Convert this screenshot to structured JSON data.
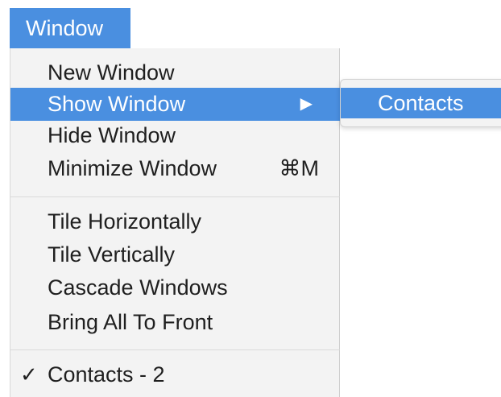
{
  "menubar": {
    "title": "Window"
  },
  "menu": {
    "new_window": "New Window",
    "show_window": "Show Window",
    "show_window_arrow": "▶",
    "hide_window": "Hide Window",
    "minimize_window": "Minimize Window",
    "minimize_shortcut": "⌘M",
    "tile_horizontally": "Tile Horizontally",
    "tile_vertically": "Tile Vertically",
    "cascade_windows": "Cascade Windows",
    "bring_all_to_front": "Bring All To Front",
    "contacts_check": "✓",
    "contacts_2": "Contacts - 2"
  },
  "submenu": {
    "contacts": "Contacts"
  },
  "colors": {
    "highlight": "#4a8fe0",
    "menu_background": "#f3f3f3"
  }
}
